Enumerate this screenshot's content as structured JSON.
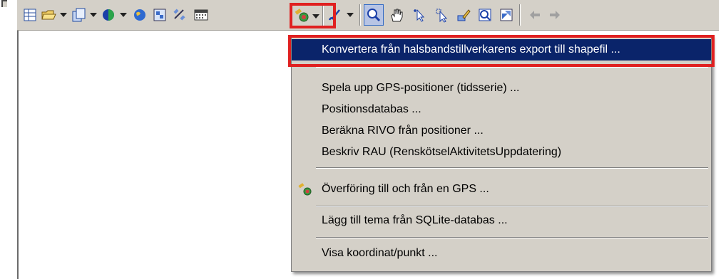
{
  "toolbar": {
    "buttons": [
      "table-icon",
      "folder-open-icon",
      "copy-icon",
      "globe-half-icon",
      "globe-icon",
      "map-grid-icon",
      "satellite-icon",
      "calendar-icon",
      "gps-satellite-icon",
      "line-draw-icon",
      "zoom-icon",
      "pan-hand-icon",
      "select-arrow-plus-icon",
      "select-arrow-icon",
      "edit-pencil-icon",
      "zoom-extent-icon",
      "layer-icon",
      "back-arrow-icon",
      "forward-arrow-icon"
    ]
  },
  "menu": {
    "items": [
      {
        "label": "Konvertera från halsbandstillverkarens export till shapefil ..."
      },
      {
        "label": "Spela upp GPS-positioner (tidsserie) ..."
      },
      {
        "label": "Positionsdatabas ..."
      },
      {
        "label": "Beräkna RIVO från positioner ..."
      },
      {
        "label": "Beskriv RAU (RenskötselAktivitetsUppdatering)"
      },
      {
        "label": "Överföring till och från en GPS ..."
      },
      {
        "label": "Lägg till tema från SQLite-databas ..."
      },
      {
        "label": "Visa koordinat/punkt ..."
      }
    ]
  },
  "colors": {
    "menu_highlight": "#0a246a",
    "annotation_box": "#e02020",
    "toolbar_bg": "#d4d0c8"
  }
}
